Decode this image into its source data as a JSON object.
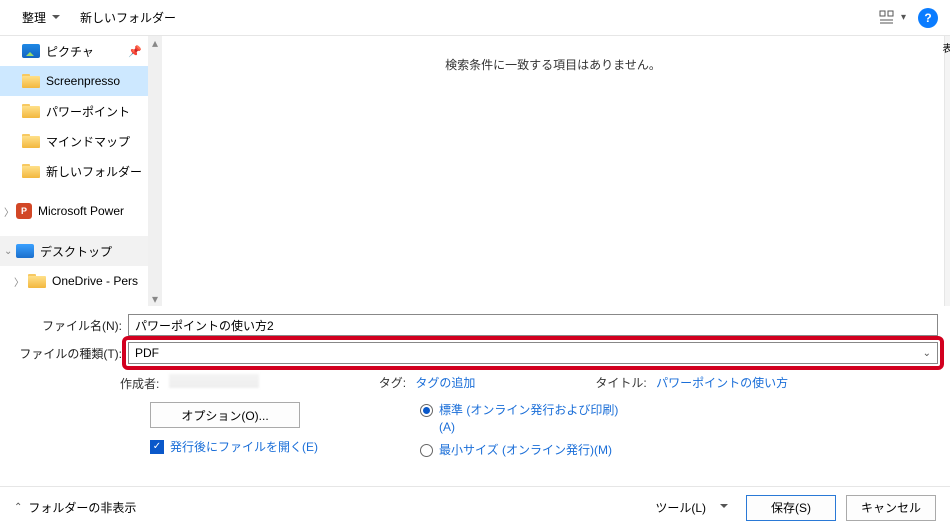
{
  "toolbar": {
    "organize": "整理",
    "new_folder": "新しいフォルダー",
    "help": "?"
  },
  "sidebar": {
    "items": [
      {
        "label": "ピクチャ",
        "icon": "pictures",
        "pinned": true
      },
      {
        "label": "Screenpresso",
        "icon": "folder",
        "selected": true
      },
      {
        "label": "パワーポイント",
        "icon": "folder"
      },
      {
        "label": "マインドマップ",
        "icon": "folder"
      },
      {
        "label": "新しいフォルダー",
        "icon": "folder"
      },
      {
        "label": "Microsoft Power",
        "icon": "powerpoint",
        "expandable": true
      },
      {
        "label": "デスクトップ",
        "icon": "desktop",
        "expanded": true,
        "group": true
      },
      {
        "label": "OneDrive - Pers",
        "icon": "folder",
        "expandable": true,
        "indent": true
      }
    ]
  },
  "content": {
    "empty_msg": "検索条件に一致する項目はありません。"
  },
  "fields": {
    "filename_label": "ファイル名(N):",
    "filename_value": "パワーポイントの使い方2",
    "filetype_label": "ファイルの種類(T):",
    "filetype_value": "PDF"
  },
  "meta": {
    "author_label": "作成者:",
    "tag_label": "タグ:",
    "tag_value": "タグの追加",
    "title_label": "タイトル:",
    "title_value": "パワーポイントの使い方"
  },
  "options": {
    "options_btn": "オプション(O)...",
    "open_after": "発行後にファイルを開く(E)",
    "radio_standard": "標準 (オンライン発行および印刷)(A)",
    "radio_minimum": "最小サイズ (オンライン発行)(M)"
  },
  "footer": {
    "hide_folders": "フォルダーの非表示",
    "tools": "ツール(L)",
    "save": "保存(S)",
    "cancel": "キャンセル"
  },
  "right_edge": "表"
}
